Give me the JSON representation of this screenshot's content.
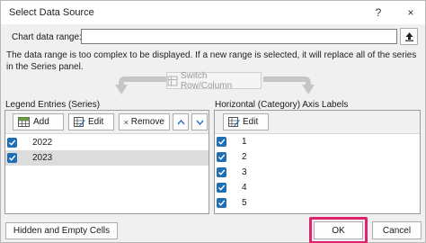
{
  "window": {
    "title": "Select Data Source",
    "help_glyph": "?",
    "close_glyph": "×"
  },
  "chart_range": {
    "label": "Chart data range:",
    "value": "",
    "message": "The data range is too complex to be displayed. If a new range is selected, it will replace all of the series in the Series panel."
  },
  "switch_button": {
    "label": "Switch Row/Column"
  },
  "legend_panel": {
    "header": "Legend Entries (Series)",
    "add_label": "Add",
    "edit_label": "Edit",
    "remove_label": "Remove",
    "items": [
      {
        "label": "2022",
        "checked": true,
        "selected": false
      },
      {
        "label": "2023",
        "checked": true,
        "selected": true
      }
    ]
  },
  "axis_panel": {
    "header": "Horizontal (Category) Axis Labels",
    "edit_label": "Edit",
    "items": [
      {
        "label": "1",
        "checked": true
      },
      {
        "label": "2",
        "checked": true
      },
      {
        "label": "3",
        "checked": true
      },
      {
        "label": "4",
        "checked": true
      },
      {
        "label": "5",
        "checked": true
      }
    ]
  },
  "footer": {
    "hidden_cells_label": "Hidden and Empty Cells",
    "ok_label": "OK",
    "cancel_label": "Cancel"
  },
  "colors": {
    "checkbox": "#1f6fb5",
    "highlight": "#e0236f",
    "selected_row": "#dcdcdc"
  }
}
